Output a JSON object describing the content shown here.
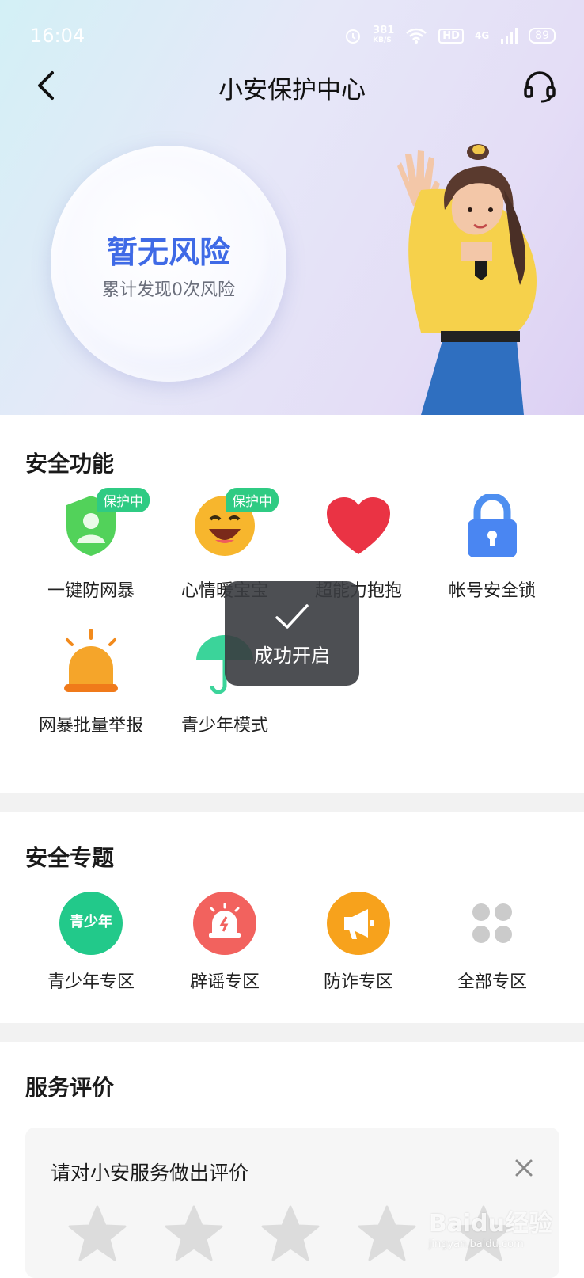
{
  "status_bar": {
    "time": "16:04",
    "net_speed_value": "381",
    "net_speed_unit": "KB/S",
    "hd": "HD",
    "signal": "4G",
    "battery": "89"
  },
  "nav": {
    "title": "小安保护中心",
    "back_icon": "chevron-left-icon",
    "service_icon": "headset-icon"
  },
  "hero": {
    "risk_status": "暂无风险",
    "risk_summary": "累计发现0次风险"
  },
  "safety_features": {
    "title": "安全功能",
    "items": [
      {
        "label": "一键防网暴",
        "badge": "保护中",
        "icon": "shield-user-icon"
      },
      {
        "label": "心情暖宝宝",
        "badge": "保护中",
        "icon": "smile-face-icon"
      },
      {
        "label": "超能力抱抱",
        "icon": "heart-icon"
      },
      {
        "label": "帐号安全锁",
        "icon": "lock-icon"
      },
      {
        "label": "网暴批量举报",
        "icon": "alarm-light-icon"
      },
      {
        "label": "青少年模式",
        "icon": "umbrella-icon"
      }
    ]
  },
  "toast": {
    "text": "成功开启"
  },
  "safety_topics": {
    "title": "安全专题",
    "items": [
      {
        "label": "青少年专区",
        "icon_text": "青少年",
        "color": "#22c98a"
      },
      {
        "label": "辟谣专区",
        "color": "#f2625e"
      },
      {
        "label": "防诈专区",
        "color": "#f7a21c"
      },
      {
        "label": "全部专区",
        "color": "#c8c8c8"
      }
    ]
  },
  "service_rating": {
    "title": "服务评价",
    "prompt": "请对小安服务做出评价",
    "star_count": 5,
    "rating": 0
  },
  "watermark": {
    "text": "Baidu经验",
    "sub": "jingyan.baidu.com"
  },
  "colors": {
    "accent_blue": "#3f6ae6",
    "badge_green": "#2fcb83"
  }
}
